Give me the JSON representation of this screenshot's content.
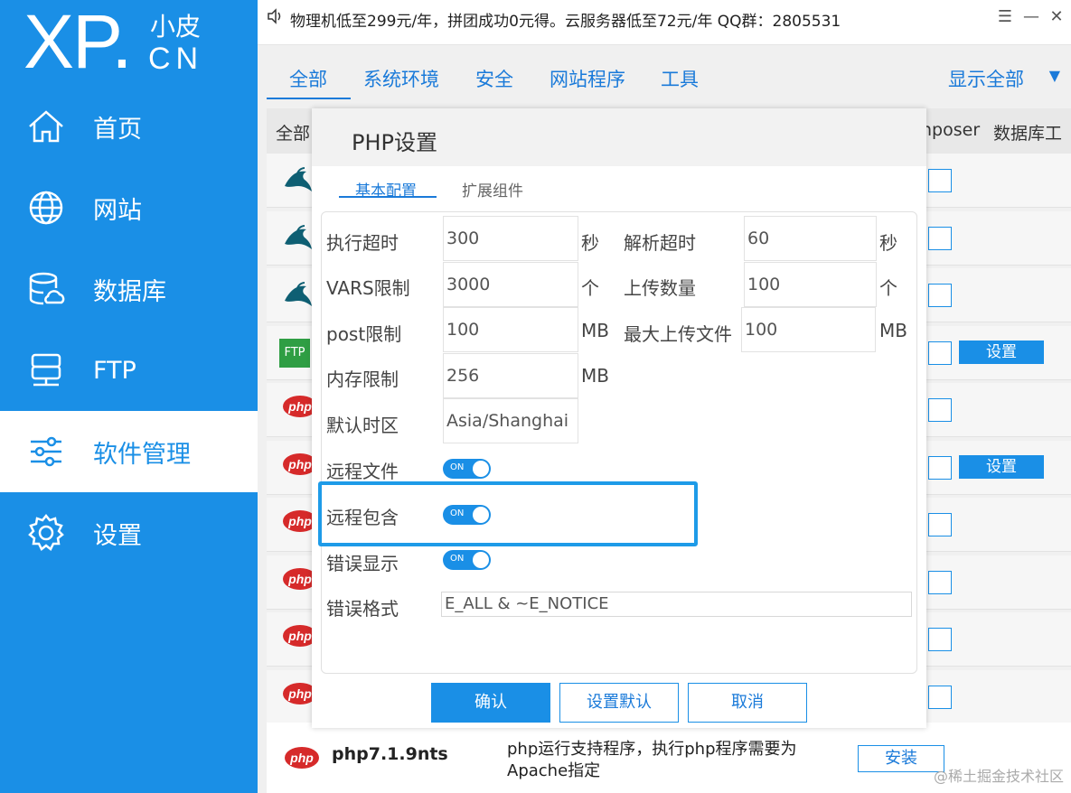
{
  "logo": {
    "xp": "XP.",
    "small": "小皮",
    "cn": "CN"
  },
  "sidebar": {
    "items": [
      {
        "label": "首页",
        "icon": "home-icon"
      },
      {
        "label": "网站",
        "icon": "globe-icon"
      },
      {
        "label": "数据库",
        "icon": "database-icon"
      },
      {
        "label": "FTP",
        "icon": "ftp-server-icon"
      },
      {
        "label": "软件管理",
        "icon": "sliders-icon",
        "active": true
      },
      {
        "label": "设置",
        "icon": "gear-icon"
      }
    ]
  },
  "topbar": {
    "notice": "物理机低至299元/年，拼团成功0元得。云服务器低至72元/年  QQ群：2805531"
  },
  "categories": {
    "tabs": [
      "全部",
      "系统环境",
      "安全",
      "网站程序",
      "工具"
    ],
    "show_all": "显示全部"
  },
  "table_header": {
    "col_all": "全部",
    "col_composer": "nposer",
    "col_dbtool": "数据库工"
  },
  "software_rows": [
    {
      "icon": "mysql-dolphin-icon",
      "button": ""
    },
    {
      "icon": "mysql-dolphin-icon",
      "button": ""
    },
    {
      "icon": "mysql-dolphin-icon",
      "button": ""
    },
    {
      "icon": "ftp-logo-icon",
      "icon_text": "FTP",
      "button": "设置"
    },
    {
      "icon": "php-logo-icon",
      "icon_text": "php",
      "button": ""
    },
    {
      "icon": "php-logo-icon",
      "icon_text": "php",
      "button": "设置"
    },
    {
      "icon": "php-logo-icon",
      "icon_text": "php",
      "button": ""
    },
    {
      "icon": "php-logo-icon",
      "icon_text": "php",
      "button": ""
    },
    {
      "icon": "php-logo-icon",
      "icon_text": "php",
      "button": ""
    },
    {
      "icon": "php-logo-icon",
      "icon_text": "php",
      "button": ""
    }
  ],
  "last_row": {
    "icon_text": "php",
    "name": "php7.1.9nts",
    "desc": "php运行支持程序，执行php程序需要为Apache指定",
    "install": "安装"
  },
  "watermark": "@稀土掘金技术社区",
  "dialog": {
    "title": "PHP设置",
    "tabs": [
      "基本配置",
      "扩展组件"
    ],
    "fields": {
      "exec_timeout": {
        "label": "执行超时",
        "value": "300",
        "unit": "秒"
      },
      "parse_timeout": {
        "label": "解析超时",
        "value": "60",
        "unit": "秒"
      },
      "vars_limit": {
        "label": "VARS限制",
        "value": "3000",
        "unit": "个"
      },
      "upload_count": {
        "label": "上传数量",
        "value": "100",
        "unit": "个"
      },
      "post_limit": {
        "label": "post限制",
        "value": "100",
        "unit": "MB"
      },
      "max_upload": {
        "label": "最大上传文件",
        "value": "100",
        "unit": "MB"
      },
      "memory_limit": {
        "label": "内存限制",
        "value": "256",
        "unit": "MB"
      },
      "timezone": {
        "label": "默认时区",
        "value": "Asia/Shanghai"
      },
      "remote_file": {
        "label": "远程文件",
        "toggle": "ON"
      },
      "remote_include": {
        "label": "远程包含",
        "toggle": "ON"
      },
      "error_display": {
        "label": "错误显示",
        "toggle": "ON"
      },
      "error_format": {
        "label": "错误格式",
        "value": "E_ALL & ~E_NOTICE"
      }
    },
    "buttons": {
      "confirm": "确认",
      "default": "设置默认",
      "cancel": "取消"
    }
  },
  "colors": {
    "primary": "#1a8fe6",
    "sidebar_bg": "#1a8fe6",
    "highlight": "#1e9be8"
  }
}
